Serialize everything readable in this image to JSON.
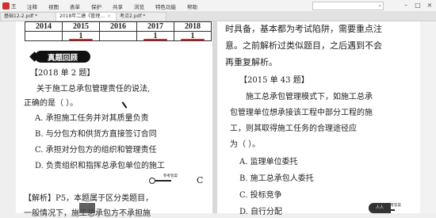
{
  "menubar": {
    "app_label": "王",
    "items": [
      "注释",
      "视图",
      "表单",
      "保护",
      "共享",
      "浏览",
      "特色功能",
      "帮助"
    ],
    "search_hint": "⌕"
  },
  "tabs": [
    {
      "label": "基础12-2.pdf *"
    },
    {
      "label": "2018年二建《管理..."
    },
    {
      "label": "考点2.pdf *"
    }
  ],
  "left_page": {
    "years": [
      "2014",
      "2015",
      "2016",
      "2017",
      "2018"
    ],
    "counts": [
      "",
      "1",
      "",
      "1",
      "1"
    ],
    "section_badge": "真题回顾",
    "question_tag": "【2018 单 2 题】",
    "stem_line1": "关于施工总承包管理责任的说法,",
    "stem_line2": "正确的是（   ）。",
    "options": [
      "A. 承担施工任务并对其质量负责",
      "B. 与分包方和供货方直接签订合同",
      "C. 承担对分包方的组织和管理责任",
      "D. 负责组织和指挥总承包单位的施工"
    ],
    "answer_tag": "参考答案",
    "answer_letter": "C",
    "analysis_line1": "【解析】P5，本题属于区分类题目，",
    "analysis_line2": "一般情况下，施工总承包方不承担施"
  },
  "right_page": {
    "intro_line1": "时具备，基本都为考试陷阱，需要重点注",
    "intro_line2": "意。之前解析过类似题目，之后遇到不会",
    "intro_line3": "再重复解析。",
    "question_tag": "【2015 单 43 题】",
    "stem_line1": "施工总承包管理模式下，如施工总承",
    "stem_line2": "包管理单位想承接该工程中部分工程的施",
    "stem_line3": "工，则其取得施工任务的合理途径应",
    "stem_line4": "为（   ）。",
    "options": [
      "A. 监理单位委托",
      "B. 施工总承包人委托",
      "C. 投标竞争",
      "D. 自行分配"
    ],
    "answer_tag": "参考答案",
    "corner_label": "人人"
  },
  "colors": {
    "accent_red": "#d22",
    "badge_bg": "#111111"
  }
}
